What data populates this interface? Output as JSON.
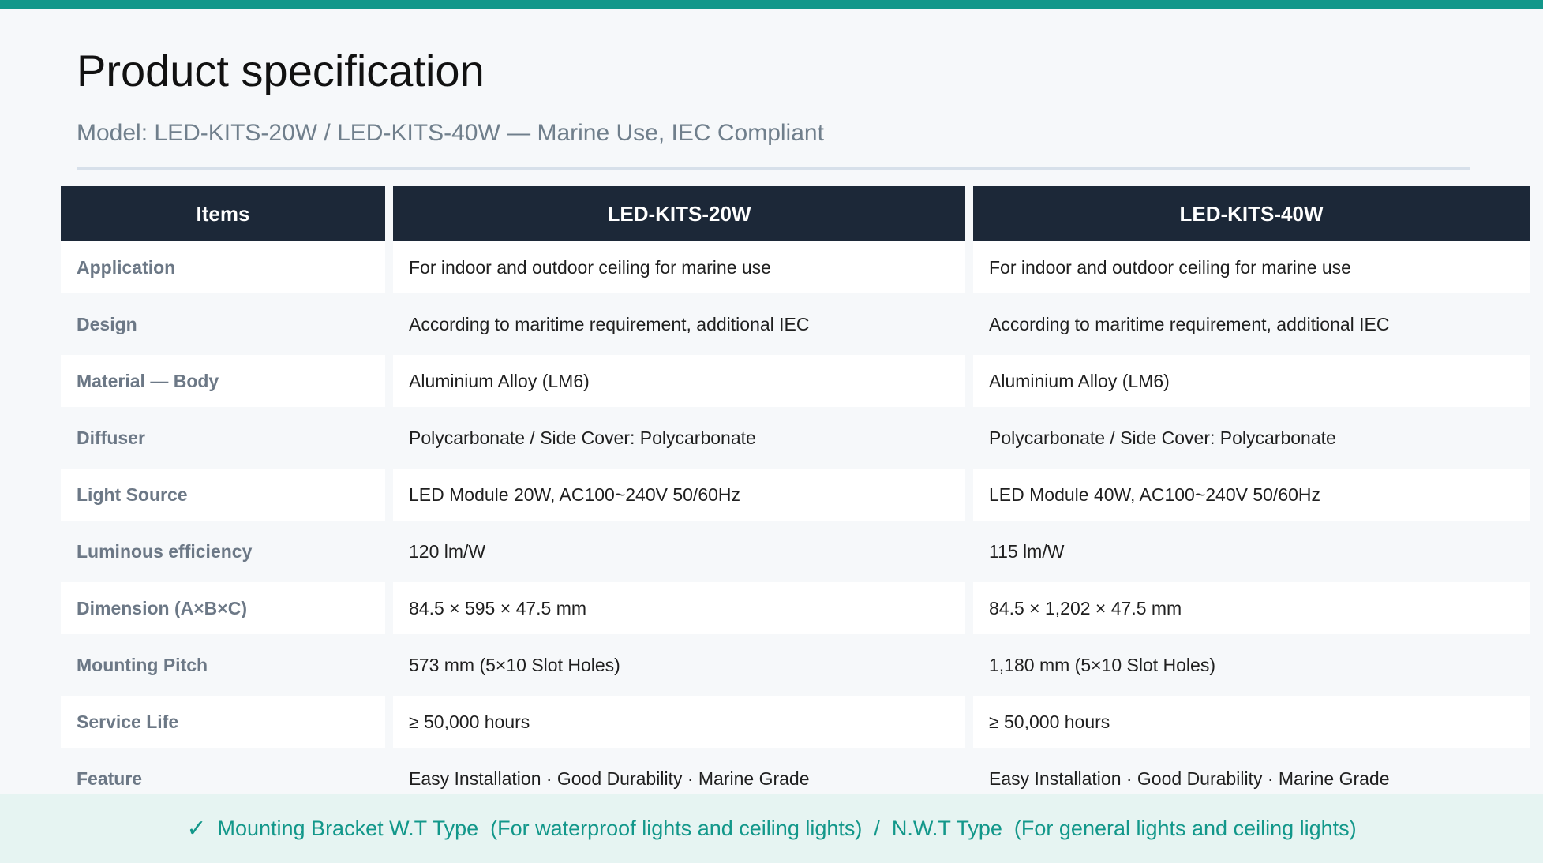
{
  "title": "Product specification",
  "subtitle": "Model: LED-KITS-20W  /  LED-KITS-40W  —  Marine Use, IEC Compliant",
  "table": {
    "headers": [
      "Items",
      "LED-KITS-20W",
      "LED-KITS-40W"
    ],
    "rows": [
      {
        "item": "Application",
        "v20": "For indoor and outdoor ceiling for marine use",
        "v40": "For indoor and outdoor ceiling for marine use"
      },
      {
        "item": "Design",
        "v20": "According to maritime requirement, additional IEC",
        "v40": "According to maritime requirement, additional IEC"
      },
      {
        "item": "Material — Body",
        "v20": "Aluminium Alloy (LM6)",
        "v40": "Aluminium Alloy (LM6)"
      },
      {
        "item": "Diffuser",
        "v20": "Polycarbonate  /  Side Cover: Polycarbonate",
        "v40": "Polycarbonate  /  Side Cover: Polycarbonate"
      },
      {
        "item": "Light Source",
        "v20": "LED Module  20W,  AC100~240V  50/60Hz",
        "v40": "LED Module  40W,  AC100~240V  50/60Hz"
      },
      {
        "item": "Luminous efficiency",
        "v20": "120 lm/W",
        "v40": "115 lm/W"
      },
      {
        "item": "Dimension (A×B×C)",
        "v20": "84.5 × 595 × 47.5 mm",
        "v40": "84.5 × 1,202 × 47.5 mm"
      },
      {
        "item": "Mounting Pitch",
        "v20": "573 mm  (5×10 Slot Holes)",
        "v40": "1,180 mm  (5×10 Slot Holes)"
      },
      {
        "item": "Service Life",
        "v20": "≥ 50,000 hours",
        "v40": "≥ 50,000 hours"
      },
      {
        "item": "Feature",
        "v20": "Easy Installation · Good Durability · Marine Grade",
        "v40": "Easy Installation · Good Durability · Marine Grade"
      }
    ]
  },
  "footer": {
    "check_icon": "✓",
    "text": "Mounting Bracket W.T Type  (For waterproof lights and ceiling lights)  /  N.W.T Type  (For general lights and ceiling lights)"
  },
  "colors": {
    "accent": "#12978a",
    "header_bg": "#1c2838",
    "footer_bg": "#e6f4f2"
  }
}
